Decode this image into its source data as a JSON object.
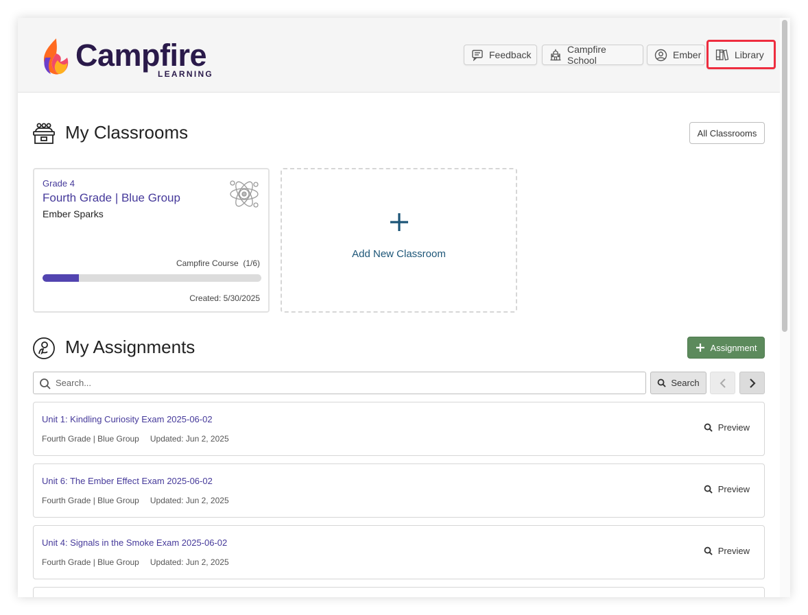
{
  "header": {
    "logo": {
      "word": "Campfire",
      "sub": "LEARNING"
    },
    "nav": {
      "feedback": "Feedback",
      "school": "Campfire School",
      "user": "Ember",
      "library": "Library"
    }
  },
  "classrooms": {
    "title": "My Classrooms",
    "all_label": "All Classrooms",
    "cards": [
      {
        "grade": "Grade 4",
        "name": "Fourth Grade | Blue Group",
        "teacher": "Ember Sparks",
        "course": "Campfire Course  (1/6)",
        "progress": 0.1667,
        "created": "Created: 5/30/2025"
      }
    ],
    "add_label": "Add New Classroom"
  },
  "assignments": {
    "title": "My Assignments",
    "add_button": "Assignment",
    "search": {
      "placeholder": "Search...",
      "button": "Search"
    },
    "items": [
      {
        "title": "Unit 1: Kindling Curiosity Exam 2025-06-02",
        "group": "Fourth Grade | Blue Group",
        "updated": "Updated: Jun 2, 2025",
        "action": "Preview"
      },
      {
        "title": "Unit 6: The Ember Effect Exam 2025-06-02",
        "group": "Fourth Grade | Blue Group",
        "updated": "Updated: Jun 2, 2025",
        "action": "Preview"
      },
      {
        "title": "Unit 4: Signals in the Smoke Exam 2025-06-02",
        "group": "Fourth Grade | Blue Group",
        "updated": "Updated: Jun 2, 2025",
        "action": "Preview"
      }
    ]
  },
  "colors": {
    "brand_purple": "#45399a",
    "progress_fill": "#5244b0",
    "assign_green": "#5c8a5c",
    "highlight_red": "#ee2d3f",
    "add_link": "#1c5577"
  },
  "icons": [
    "flame-logo-icon",
    "feedback-icon",
    "school-icon",
    "user-circle-icon",
    "library-icon",
    "classroom-icon",
    "atom-icon",
    "plus-icon",
    "assignment-icon",
    "search-icon",
    "chevron-left-icon",
    "chevron-right-icon",
    "magnifier-icon"
  ]
}
